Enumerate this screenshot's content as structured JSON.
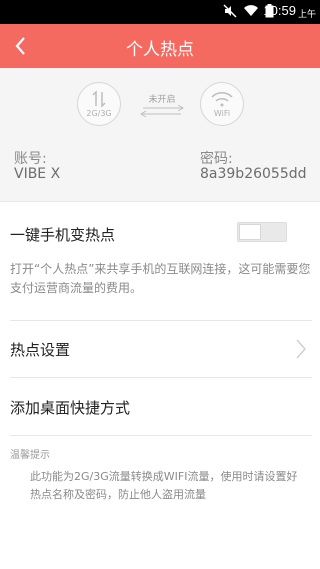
{
  "status_bar": {
    "time": "10:59",
    "ampm": "上午",
    "icons": [
      "mute-icon",
      "wifi-signal-icon",
      "battery-icon"
    ]
  },
  "header": {
    "title": "个人热点",
    "back_icon": "chevron-left-icon",
    "background_color": "#f46a60"
  },
  "hero": {
    "left_circle_caption": "2G/3G",
    "right_circle_caption": "WiFi",
    "connection_status": "未开启",
    "account_label": "账号:",
    "account_value": "VIBE X",
    "password_label": "密码:",
    "password_value": "8a39b26055dd"
  },
  "hotspot_toggle": {
    "label": "一键手机变热点",
    "state": "off"
  },
  "description": "打开“个人热点”来共享手机的互联网连接，这可能需要您支付运营商流量的费用。",
  "menu": {
    "hotspot_settings": "热点设置",
    "add_shortcut": "添加桌面快捷方式"
  },
  "tips": {
    "title": "温馨提示",
    "body": "此功能为2G/3G流量转换成WIFI流量，使用时请设置好热点名称及密码，防止他人盗用流量"
  }
}
